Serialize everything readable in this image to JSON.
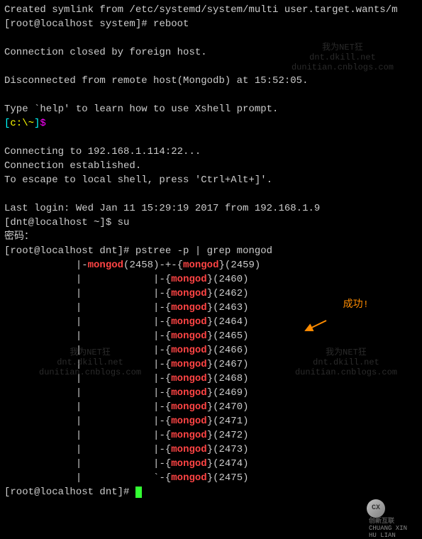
{
  "topLine": "Created symlink from /etc/systemd/system/multi user.target.wants/m",
  "prompt1": "[root@localhost system]# ",
  "cmd1": "reboot",
  "blank": "",
  "msg_closed": "Connection closed by foreign host.",
  "msg_disconnected": "Disconnected from remote host(Mongodb) at 15:52:05.",
  "msg_help": "Type `help' to learn how to use Xshell prompt.",
  "prompt_c_open": "[",
  "prompt_c_path": "c:\\~",
  "prompt_c_close": "]",
  "prompt_c_dollar": "$",
  "msg_connecting": "Connecting to 192.168.1.114:22...",
  "msg_established": "Connection established.",
  "msg_escape": "To escape to local shell, press 'Ctrl+Alt+]'.",
  "msg_lastlogin": "Last login: Wed Jan 11 15:29:19 2017 from 192.168.1.9",
  "prompt_dnt": "[dnt@localhost ~]$ ",
  "cmd_su": "su",
  "msg_password": "密码：",
  "prompt_root_dnt": "[root@localhost dnt]# ",
  "cmd_pstree": "pstree -p | grep mongod",
  "tree_prefix_first": "            |-",
  "tree_prefix_pipe": "            |            ",
  "tree_branch_mid": "|-{",
  "tree_branch_first_mid": "-+-{",
  "tree_branch_last": "`-{",
  "mongod": "mongod",
  "parent_open": "(",
  "parent_close_dash": ")",
  "brace_close_paren": "}(",
  "pid_parent": "2458",
  "pids": [
    "2459",
    "2460",
    "2462",
    "2463",
    "2464",
    "2465",
    "2466",
    "2467",
    "2468",
    "2469",
    "2470",
    "2471",
    "2472",
    "2473",
    "2474",
    "2475"
  ],
  "close_paren": ")",
  "prompt_final": "[root@localhost dnt]# ",
  "watermark_line1": "我为NET狂",
  "watermark_line2": "dnt.dkill.net",
  "watermark_line3": "dunitian.cnblogs.com",
  "annotation_success": "成功!",
  "logo_cx": "CX",
  "logo_brand_cn": "创新互联",
  "logo_brand_en": "CHUANG XIN HU LIAN"
}
